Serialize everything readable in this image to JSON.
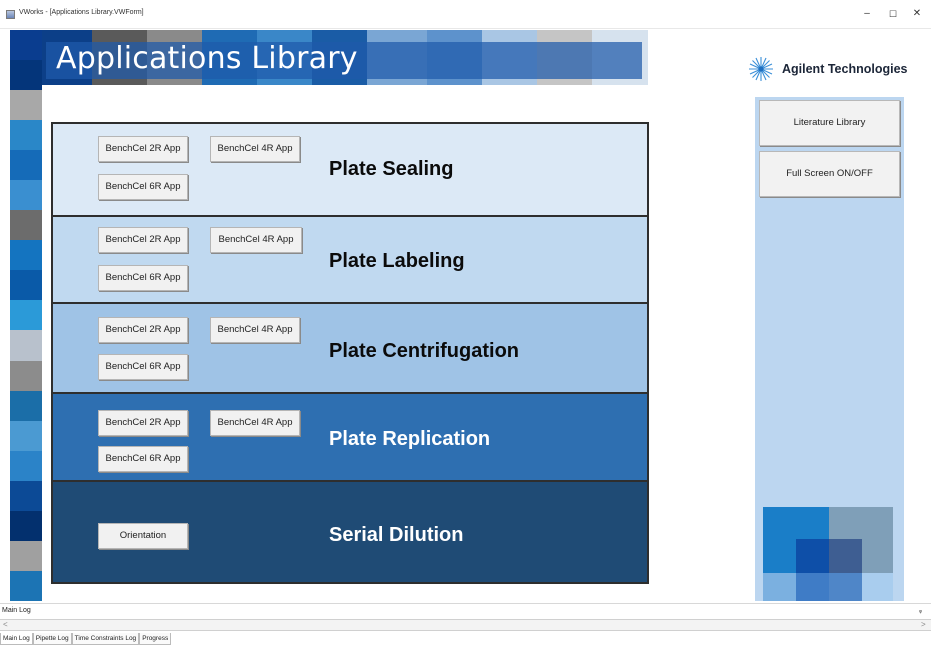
{
  "window": {
    "title": "VWorks - [Applications Library.VWForm]",
    "min_glyph": "–",
    "max_glyph": "☐",
    "close_glyph": "✕"
  },
  "header": {
    "title": "Applications Library",
    "brand": "Agilent Technologies"
  },
  "sections": [
    {
      "name": "Plate Sealing",
      "buttons": [
        "BenchCel 2R App",
        "BenchCel 4R App",
        "BenchCel 6R App"
      ],
      "bg": "#dce9f6",
      "text_color": "#0b0b0b"
    },
    {
      "name": "Plate Labeling",
      "buttons": [
        "BenchCel 2R App",
        "BenchCel 4R App",
        "BenchCel 6R App"
      ],
      "bg": "#c0d9f0",
      "text_color": "#0b0b0b"
    },
    {
      "name": "Plate Centrifugation",
      "buttons": [
        "BenchCel 2R App",
        "BenchCel 4R App",
        "BenchCel 6R App"
      ],
      "bg": "#9fc3e6",
      "text_color": "#0b0b0b"
    },
    {
      "name": "Plate Replication",
      "buttons": [
        "BenchCel 2R App",
        "BenchCel 4R App",
        "BenchCel 6R App"
      ],
      "bg": "#2e6fb1",
      "text_color": "#ffffff"
    },
    {
      "name": "Serial Dilution",
      "buttons": [
        "Orientation"
      ],
      "bg": "#1f4b75",
      "text_color": "#ffffff"
    }
  ],
  "right_panel": {
    "buttons": [
      "Literature Library",
      "Full Screen ON/OFF"
    ]
  },
  "log": {
    "label": "Main Log",
    "pin": "ᵩ",
    "scroll_left": "<",
    "scroll_right": ">",
    "tabs": [
      "Main Log",
      "Pipette Log",
      "Time Constraints Log",
      "Progress"
    ]
  },
  "colors": {
    "accent_dark": "#1f4b75",
    "accent_mid": "#2e6fb1",
    "right_panel_bg": "#bcd6f0"
  }
}
